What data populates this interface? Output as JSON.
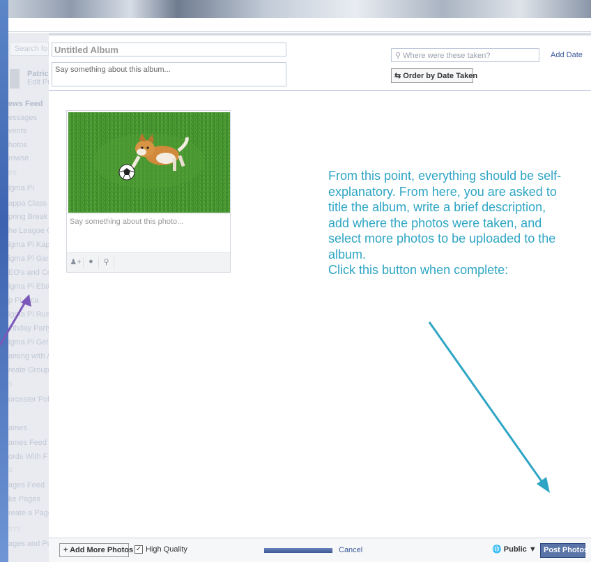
{
  "sidebar": {
    "search_placeholder": "Search fo",
    "profile_name": "Patrick C",
    "profile_edit": "Edit Profi",
    "items": [
      {
        "label": "ews Feed",
        "bold": true
      },
      {
        "label": "essages"
      },
      {
        "label": "vents"
      },
      {
        "label": "hotos"
      },
      {
        "label": "rowse"
      },
      {
        "label": "PS",
        "section": true
      },
      {
        "label": "igma Pi"
      },
      {
        "label": "appa Class"
      },
      {
        "label": "pring Break"
      },
      {
        "label": "he League C"
      },
      {
        "label": "igma Pi Kap"
      },
      {
        "label": "igma Pi Gan"
      },
      {
        "label": "EO's and Co"
      },
      {
        "label": "igma Pi Eba"
      },
      {
        "label": "p Pi arca"
      },
      {
        "label": "igma Pi Rus"
      },
      {
        "label": "irthday Party"
      },
      {
        "label": "igma Pi Get"
      },
      {
        "label": "aming with /"
      },
      {
        "label": "reate Group"
      },
      {
        "label": "S",
        "section": true
      },
      {
        "label": "orcester Pol"
      },
      {
        "label": "",
        "section": true
      },
      {
        "label": "ames"
      },
      {
        "label": "ames Feed"
      },
      {
        "label": "ords With F"
      },
      {
        "label": "S",
        "section": true
      },
      {
        "label": "ages Feed"
      },
      {
        "label": "ke Pages"
      },
      {
        "label": "reate a Page"
      },
      {
        "label": "STS",
        "section": true
      },
      {
        "label": "ages and Pu"
      }
    ]
  },
  "header": {
    "album_title_placeholder": "Untitled Album",
    "album_desc_placeholder": "Say something about this album...",
    "where_placeholder": "Where were these taken?",
    "add_date": "Add Date",
    "order_button": "Order by Date Taken"
  },
  "photo": {
    "caption_placeholder": "Say something about this photo..."
  },
  "annotation": {
    "text": "From this point, everything should be self-explanatory. From here, you are asked to title the album, write a brief description, add where the photos were taken, and select more photos to be uploaded to the album.",
    "text2": "Click this button when complete:"
  },
  "footer": {
    "add_more": "+ Add More Photos",
    "high_quality": "High Quality",
    "cancel": "Cancel",
    "privacy": "Public",
    "post": "Post Photos",
    "upload_progress": 1.0
  },
  "colors": {
    "annotation": "#2ea5c4",
    "arrow_teal": "#2ea5c4",
    "arrow_purple": "#7a57b8",
    "fb_blue": "#3b5998"
  }
}
